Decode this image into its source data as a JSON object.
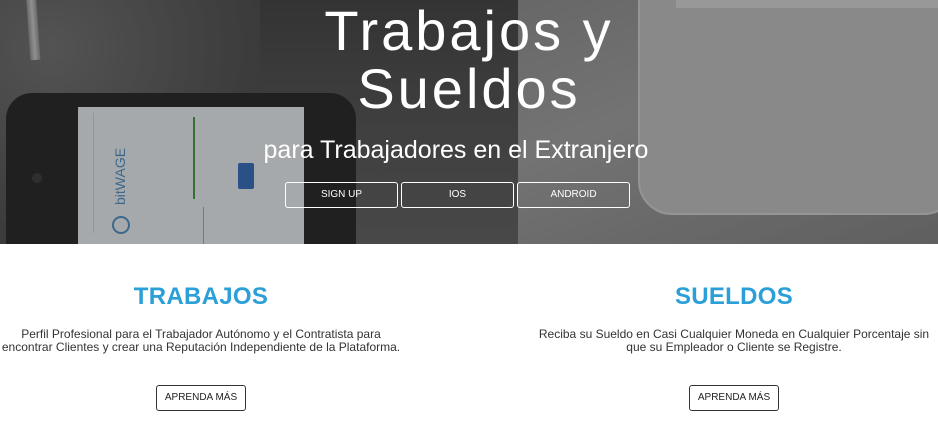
{
  "hero": {
    "title_line1": "Trabajos y",
    "title_line2": "Sueldos",
    "subtitle": "para Trabajadores en el Extranjero",
    "buttons": [
      {
        "label": "SIGN UP"
      },
      {
        "label": "IOS"
      },
      {
        "label": "ANDROID"
      }
    ]
  },
  "features": [
    {
      "title": "TRABAJOS",
      "text": "Perfil Profesional para el Trabajador Autónomo y el Contratista para encontrar Clientes y crear una Reputación Independiente de la Plataforma.",
      "button": "APRENDA MÁS"
    },
    {
      "title": "SUELDOS",
      "text": "Reciba su Sueldo en Casi Cualquier Moneda en Cualquier Porcentaje sin que su Empleador o Cliente se Registre.",
      "button": "APRENDA MÁS"
    }
  ],
  "colors": {
    "accent": "#2a9fd8",
    "text": "#333333"
  }
}
